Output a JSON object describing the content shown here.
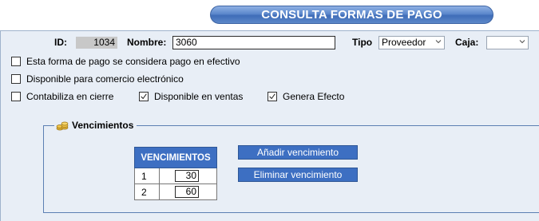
{
  "header": {
    "title": "CONSULTA FORMAS DE PAGO"
  },
  "form": {
    "id_label": "ID:",
    "id_value": "1034",
    "nombre_label": "Nombre:",
    "nombre_value": "3060",
    "tipo_label": "Tipo",
    "tipo_value": "Proveedor",
    "caja_label": "Caja:",
    "caja_value": ""
  },
  "checkboxes": [
    {
      "label": "Esta forma de pago se considera pago en efectivo",
      "checked": false
    },
    {
      "label": "Disponible para comercio electrónico",
      "checked": false
    },
    {
      "label": "Contabiliza en cierre",
      "checked": false
    },
    {
      "label": "Disponible en ventas",
      "checked": true
    },
    {
      "label": "Genera Efecto",
      "checked": true
    }
  ],
  "vencimientos": {
    "legend": "Vencimientos",
    "table_header": "VENCIMIENTOS",
    "rows": [
      {
        "num": "1",
        "value": "30"
      },
      {
        "num": "2",
        "value": "60"
      }
    ],
    "add_button": "Añadir vencimiento",
    "delete_button": "Eliminar vencimiento"
  },
  "colors": {
    "accent": "#3d6fc2",
    "panel_bg": "#e8eef6"
  }
}
